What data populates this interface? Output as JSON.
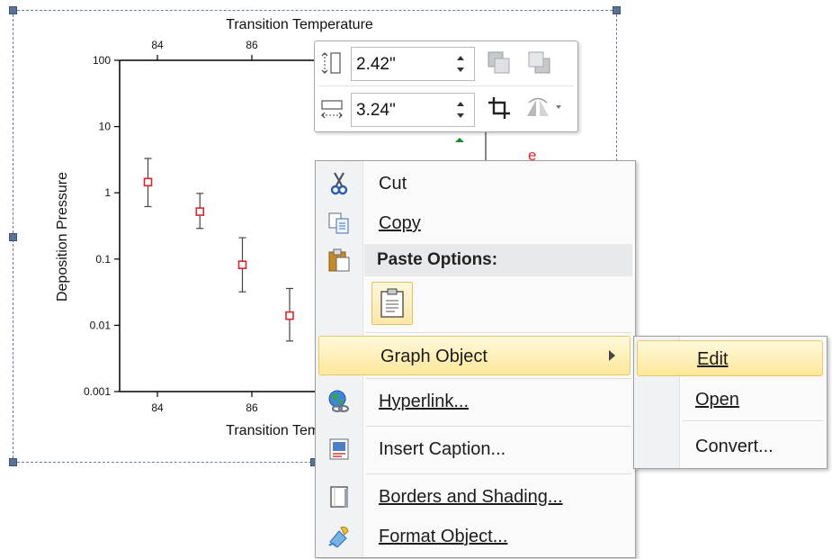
{
  "chart_data": {
    "type": "scatter",
    "title": "Transition Temperature",
    "xlabel": "Transition Temperature",
    "ylabel": "Deposition Pressure",
    "x_ticks": [
      "84",
      "86"
    ],
    "top_x_ticks": [
      "84",
      "86"
    ],
    "y_ticks": [
      "100",
      "10",
      "1",
      "0.1",
      "0.01",
      "0.001"
    ],
    "yscale": "log",
    "xlim": [
      83.2,
      93.0
    ],
    "ylim": [
      0.001,
      100
    ],
    "points": [
      {
        "x": 83.8,
        "y": 1.45,
        "err_low": 0.62,
        "err_high": 3.3
      },
      {
        "x": 84.9,
        "y": 0.52,
        "err_low": 0.29,
        "err_high": 0.98
      },
      {
        "x": 85.8,
        "y": 0.082,
        "err_low": 0.032,
        "err_high": 0.21
      },
      {
        "x": 86.8,
        "y": 0.014,
        "err_low": 0.0058,
        "err_high": 0.036
      }
    ],
    "marker_color": "#e0242c",
    "hidden_marker_label": "e"
  },
  "mini_toolbar": {
    "height_value": "2.42\"",
    "width_value": "3.24\"",
    "icons": [
      "shape-height-icon",
      "bring-forward-icon",
      "send-backward-icon",
      "shape-width-icon",
      "crop-icon",
      "rotate-icon"
    ]
  },
  "context_menu": {
    "cut": "Cut",
    "copy": "Copy",
    "paste_options": "Paste Options:",
    "graph_object": "Graph Object",
    "hyperlink": "Hyperlink...",
    "insert_caption": "Insert Caption...",
    "borders_and_shading": "Borders and Shading...",
    "format_object": "Format Object..."
  },
  "sub_menu": {
    "edit": "Edit",
    "open": "Open",
    "convert": "Convert..."
  }
}
